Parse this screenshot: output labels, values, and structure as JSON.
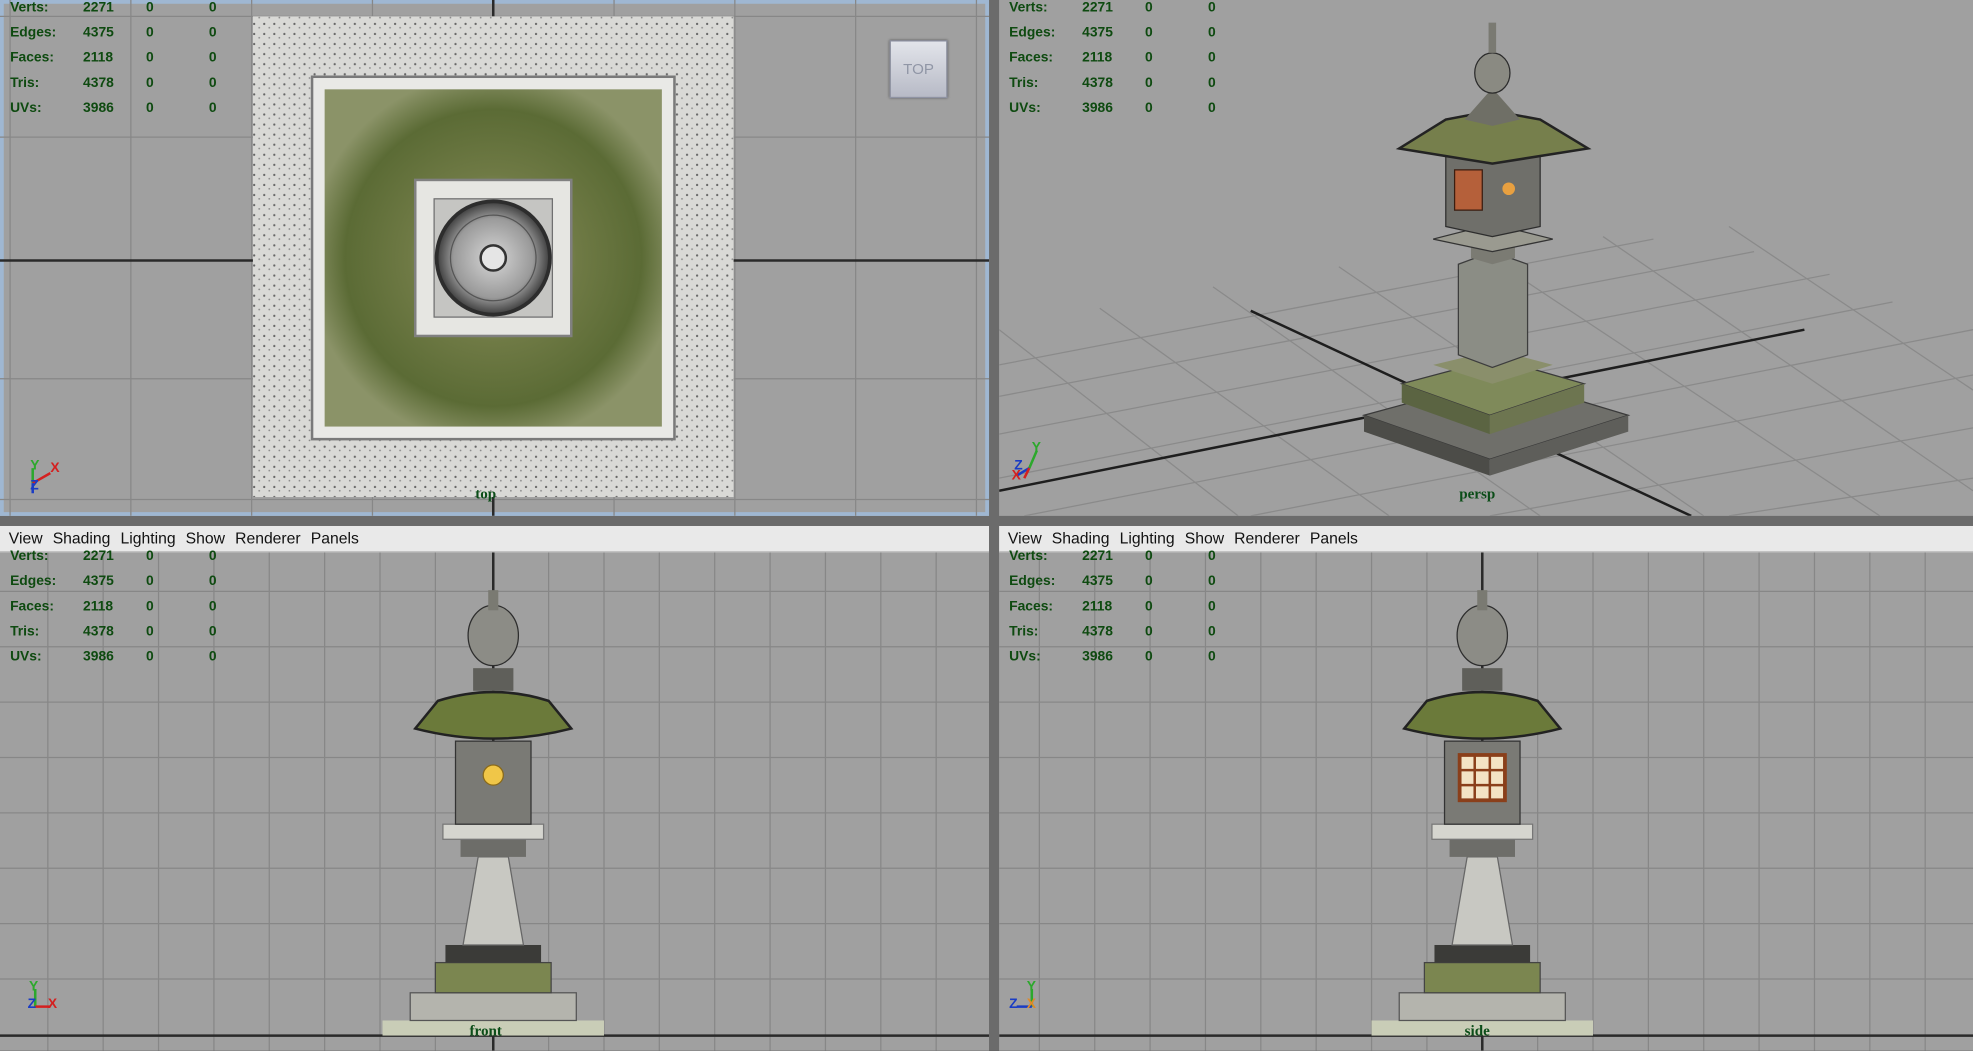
{
  "menu": [
    "View",
    "Shading",
    "Lighting",
    "Show",
    "Renderer",
    "Panels"
  ],
  "hud": {
    "rows": [
      {
        "label": "Verts:",
        "value": "2271",
        "a": "0",
        "b": "0"
      },
      {
        "label": "Edges:",
        "value": "4375",
        "a": "0",
        "b": "0"
      },
      {
        "label": "Faces:",
        "value": "2118",
        "a": "0",
        "b": "0"
      },
      {
        "label": "Tris:",
        "value": "4378",
        "a": "0",
        "b": "0"
      },
      {
        "label": "UVs:",
        "value": "3986",
        "a": "0",
        "b": "0"
      }
    ]
  },
  "viewports": {
    "top": {
      "camera": "top",
      "view_cube": "TOP",
      "axes": [
        "Y",
        "X",
        "Z"
      ]
    },
    "persp": {
      "camera": "persp",
      "axes": [
        "Y",
        "Z",
        "X"
      ]
    },
    "front": {
      "camera": "front",
      "axes": [
        "Y",
        "Z",
        "X"
      ]
    },
    "side": {
      "camera": "side",
      "axes": [
        "Y",
        "Z",
        "X"
      ]
    }
  },
  "colors": {
    "viewport_bg": "#a0a0a0",
    "grid": "#878787",
    "hud_text": "#0e4a10",
    "active_border": "#9fb7d2",
    "axis_x": "#d42020",
    "axis_y": "#2ca82c",
    "axis_z": "#1a3cc4"
  }
}
